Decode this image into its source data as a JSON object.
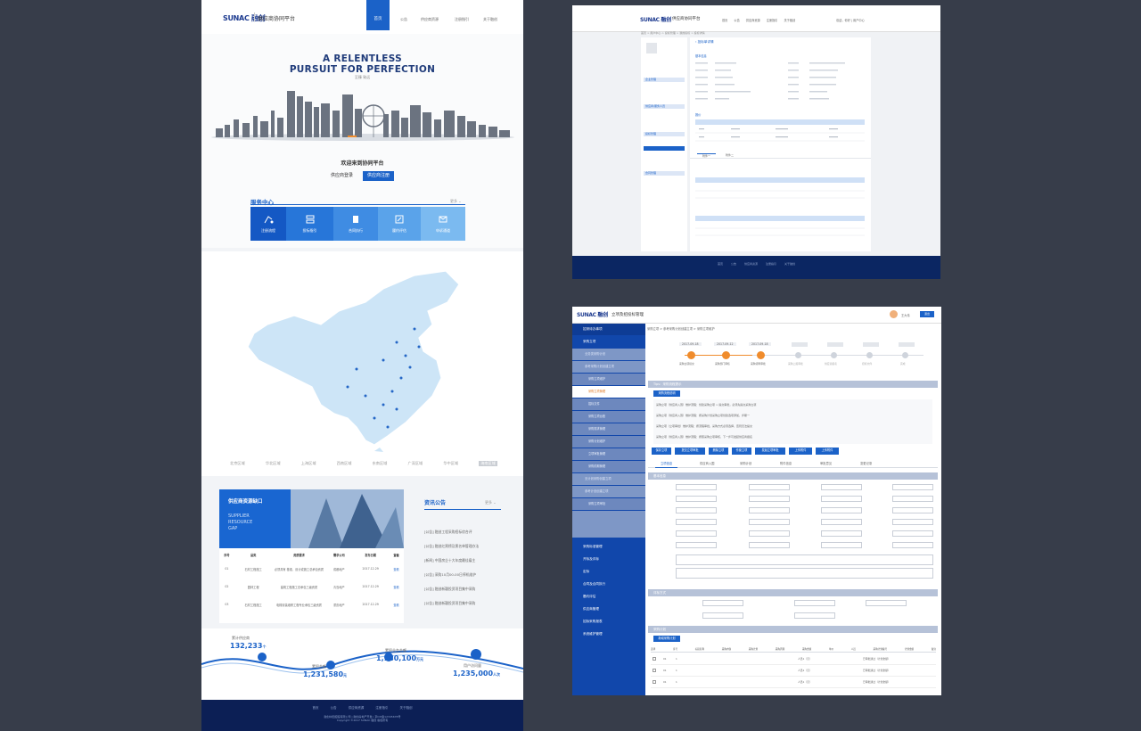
{
  "left_page": {
    "logo": "SUNAC 融创",
    "platform": "供应商协同平台",
    "nav": [
      "首页",
      "公告",
      "供应商资源",
      "注册指引",
      "关于融创"
    ],
    "hero_line1": "A RELENTLESS",
    "hero_line2": "PURSUIT FOR PERFECTION",
    "hero_sub": "至臻 致远",
    "welcome": "欢迎来到协同平台",
    "login": "供应商登录",
    "register": "供应商注册",
    "service_title": "服务中心",
    "service_more": "更多",
    "services": [
      "注册流程",
      "投标指引",
      "合同执行",
      "履约评估",
      "申诉通道"
    ],
    "regions": [
      "北京区域",
      "华北区域",
      "上海区域",
      "西南区域",
      "东南区域",
      "广深区域",
      "华中区域",
      "海南区域"
    ],
    "resource_title": "供应商资源缺口",
    "resource_en": [
      "SUPPLIER",
      "RESOURCE",
      "GAP"
    ],
    "table_head": [
      "序号",
      "品类",
      "资质要求",
      "需求公司",
      "发布日期",
      "查看"
    ],
    "table_rows": [
      [
        "01",
        "石材工程施工",
        "必须具有 基准、设计或施工总承包资质",
        "成都地产",
        "2017.12.29",
        "查看"
      ],
      [
        "02",
        "园林工程",
        "建筑工程施工总承包三级资质",
        "青岛地产",
        "2017.12.29",
        "查看"
      ],
      [
        "03",
        "石材工程施工",
        "电梯安装维修工程专业承包三级资质",
        "重庆地产",
        "2017.12.29",
        "查看"
      ]
    ],
    "news_title": "资讯公告",
    "news_more": "更多",
    "news": [
      "[公告] 融创工程采购招标综合评",
      "[公告] 融创红黑榜及黑名单管理办法",
      "[新闻] 中国房企十大年度最佳雇主",
      "[公告] 采购10月00-00日停机维护",
      "[公告] 融创新疆投资项目集中采购",
      "[公告] 融创新疆投资项目集中采购"
    ],
    "stats": [
      {
        "label": "累计供应商",
        "value": "132,233",
        "unit": "个"
      },
      {
        "label": "累积金额",
        "value": "1,231,580",
        "unit": "元"
      },
      {
        "label": "累积业务金额",
        "value": "1,180,100",
        "unit": "万元"
      },
      {
        "label": "用户访问量",
        "value": "1,235,000",
        "unit": "人次"
      }
    ],
    "footer_links": [
      "首页",
      "公告",
      "供应商资源",
      "注册指引",
      "关于融创"
    ],
    "footer_copy": "融创中国控股有限公司 | 融创房地产开发 | 京ICP备12345678号",
    "footer_copy2": "Copyright ©2017 SUNAC 融创 版权所有"
  },
  "right_top": {
    "logo": "SUNAC 融创",
    "platform": "供应商协同平台",
    "nav": [
      "首页",
      "公告",
      "供应商资源",
      "注册指引",
      "关于融创"
    ],
    "user": "欢迎，你好 | 用户中心",
    "breadcrumb": "首页 > 用户中心 > 投标管理 > 我的投标 > 投标详情",
    "page_title": "投标单详情",
    "section1": "基本信息",
    "section2": "报价",
    "tabs": [
      "附件一",
      "附件二"
    ],
    "side_groups": [
      "企业管理",
      "供应商/服务人员",
      "投标管理",
      "合同管理"
    ],
    "footer_links": [
      "首页",
      "公告",
      "供应商资源",
      "注册指引",
      "关于融创"
    ]
  },
  "right_bottom": {
    "logo": "SUNAC 融创",
    "platform": "立项及招投标管理",
    "user": "王大伟",
    "logout_btn": "退出",
    "breadcrumb": "采购立项 > 参考采购计划创建立项 > 采购立项维护",
    "sidebar": [
      "招采待办事项",
      "采购立项",
      "业务类采购计划",
      "参考采购计划创建立项",
      "采购立项维护",
      "采购立项管理",
      "招标文件",
      "采购立项台账",
      "采购需求管理",
      "采购计划维护",
      "立项审批管理",
      "采购前期管理",
      "无计划采购创建立项",
      "参考计划创建立项",
      "采购立项审批"
    ],
    "sidebar_bottom": [
      "采购标准管理",
      "开标及评标",
      "定标",
      "合同及合同执行",
      "履约评估",
      "供应商管理",
      "招标采购报表",
      "系统维护管理"
    ],
    "steps_dates": [
      "2017-09-18",
      "2017-09-12",
      "2017-09-18"
    ],
    "steps": [
      "采购立项提交",
      "采购部门审核",
      "采购领导审批",
      "采购上报审批",
      "供应商报名",
      "招标文件",
      "完成"
    ],
    "tip_title": "Tips：采购流程提示",
    "tip_btn": "采购流程说明",
    "tips": [
      "采购立项（供应商入围）维护流程：创建采购立项 > 提交审批，必须先提交采购立项",
      "采购立项（供应商入围）维护流程：按采购计划采购立项创建选项添加，步骤一",
      "采购立项（立项审批）维护流程：按流程审批，采购方式必须选择，否则无法提交",
      "采购立项（供应商入围）维护流程：按照采购立项审核，下一步可发起供应商报名"
    ],
    "action_buttons": [
      "保存立项",
      "提交立项审批",
      "删除立项",
      "作废立项",
      "发起立项审批",
      "上传附件",
      "上传附件"
    ],
    "form_tabs": [
      "立项信息",
      "供应商入围",
      "采购计划",
      "附件信息",
      "审批意见",
      "变更记录"
    ],
    "section_basic": "基本信息",
    "section_eval": "评标方式",
    "section_plan": "采购计划",
    "plan_btn": "新增采购计划",
    "plan_head": [
      "选择",
      "序号",
      "标段名称",
      "采购内容",
      "采购计划",
      "采购周期",
      "采购金额",
      "单价",
      "人员",
      "采购计划编号",
      "计划金额",
      "备注"
    ],
    "plan_rows": [
      [
        "01",
        "1",
        "人员1（元）",
        "已审批通过（计划金额）"
      ],
      [
        "01",
        "1",
        "人员1（元）",
        "已审批通过（计划金额）"
      ],
      [
        "01",
        "1",
        "人员1（元）",
        "已审批通过（计划金额）"
      ]
    ]
  }
}
